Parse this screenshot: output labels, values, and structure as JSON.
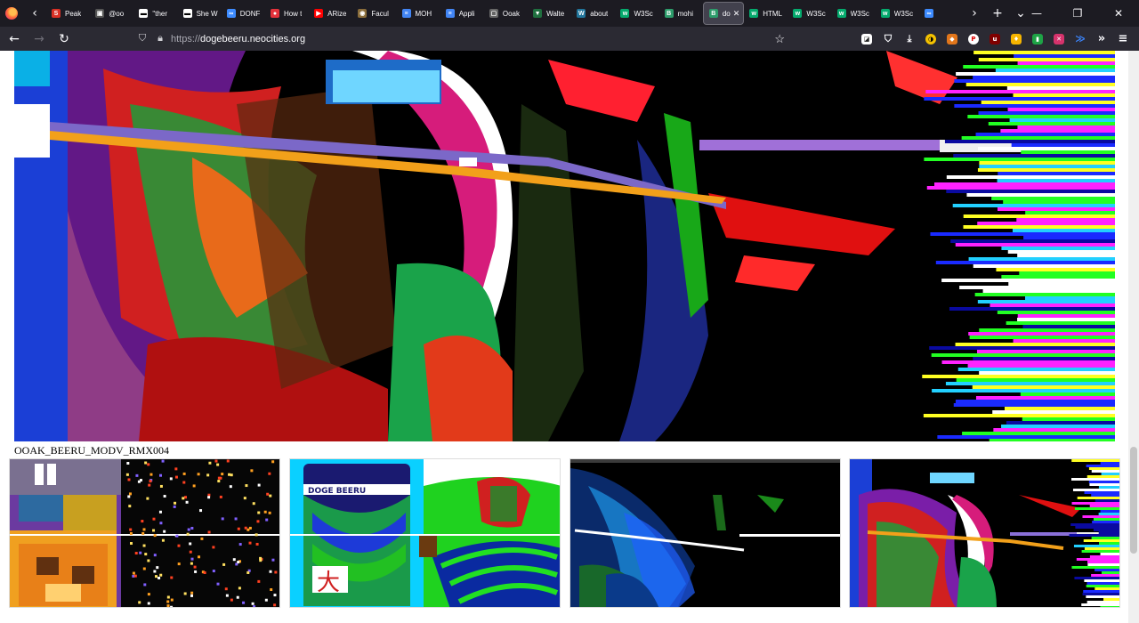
{
  "browser": {
    "tabs": [
      {
        "label": "Peak",
        "fav_color": "#d93025",
        "fav_glyph": "S"
      },
      {
        "label": "@oo",
        "fav_color": "#555",
        "fav_glyph": "▣"
      },
      {
        "label": "\"ther",
        "fav_color": "#fff",
        "fav_glyph": "▬"
      },
      {
        "label": "She W",
        "fav_color": "#fff",
        "fav_glyph": "▬"
      },
      {
        "label": "DONF",
        "fav_color": "#3d8bff",
        "fav_glyph": "∞"
      },
      {
        "label": "How t",
        "fav_color": "#e5323b",
        "fav_glyph": "●"
      },
      {
        "label": "ARize",
        "fav_color": "#ff0000",
        "fav_glyph": "▶"
      },
      {
        "label": "Facul",
        "fav_color": "#8a6d3b",
        "fav_glyph": "◉"
      },
      {
        "label": "MOH",
        "fav_color": "#4285f4",
        "fav_glyph": "≡"
      },
      {
        "label": "Appli",
        "fav_color": "#4285f4",
        "fav_glyph": "≡"
      },
      {
        "label": "Ooak",
        "fav_color": "#666",
        "fav_glyph": "▢"
      },
      {
        "label": "Walte",
        "fav_color": "#1f6f3f",
        "fav_glyph": "▼"
      },
      {
        "label": "about",
        "fav_color": "#21759b",
        "fav_glyph": "W"
      },
      {
        "label": "W3Sc",
        "fav_color": "#04aa6d",
        "fav_glyph": "w"
      },
      {
        "label": "mohi",
        "fav_color": "#2d9c6b",
        "fav_glyph": "B"
      },
      {
        "label": "do",
        "fav_color": "#2d9c6b",
        "fav_glyph": "B",
        "active": true
      },
      {
        "label": "HTML",
        "fav_color": "#04aa6d",
        "fav_glyph": "w"
      },
      {
        "label": "W3Sc",
        "fav_color": "#04aa6d",
        "fav_glyph": "w"
      },
      {
        "label": "W3Sc",
        "fav_color": "#04aa6d",
        "fav_glyph": "w"
      },
      {
        "label": "W3Sc",
        "fav_color": "#04aa6d",
        "fav_glyph": "w"
      },
      {
        "label": "",
        "fav_color": "#3d8bff",
        "fav_glyph": "∞"
      }
    ],
    "url_prefix": "https://",
    "url_host": "dogebeeru.neocities.org",
    "url_suffix": ""
  },
  "page": {
    "caption": "OOAK_BEERU_MODV_RMX004"
  },
  "icons": {
    "back": "arrow-left-icon",
    "forward": "arrow-right-icon",
    "reload": "reload-icon",
    "shield": "shield-icon",
    "lock": "lock-icon",
    "star": "star-icon"
  }
}
